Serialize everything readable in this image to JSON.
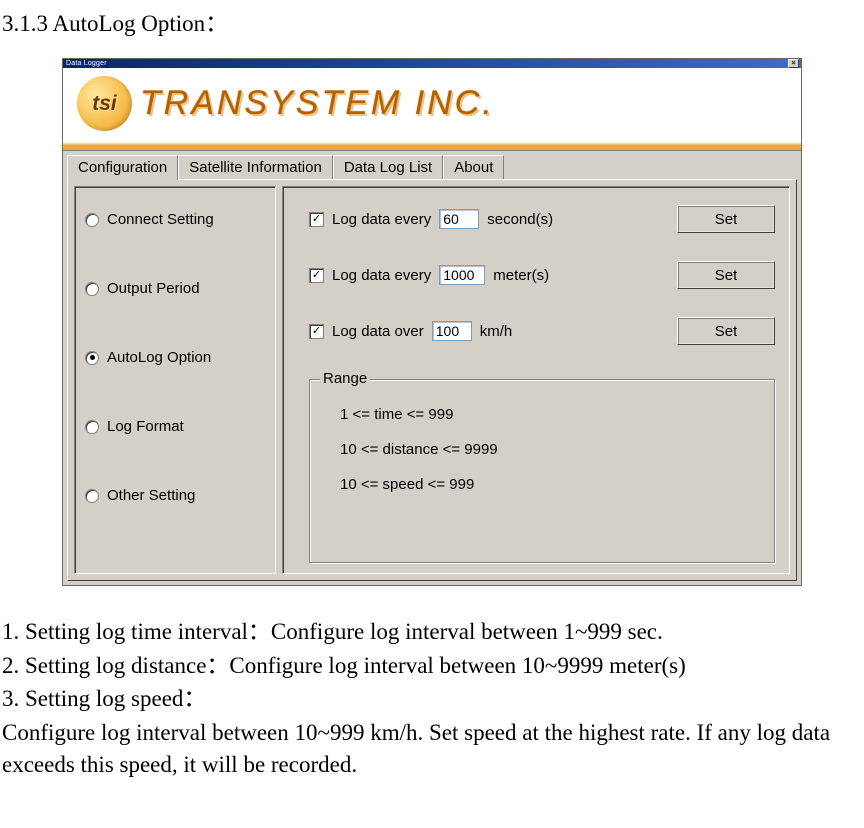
{
  "heading": "3.1.3 AutoLog Option：",
  "window": {
    "title": "Data Logger",
    "logo_tsi": "tsi",
    "logo_company": "TRANSYSTEM INC."
  },
  "tabs": {
    "items": [
      {
        "label": "Configuration",
        "active": true
      },
      {
        "label": "Satellite Information",
        "active": false
      },
      {
        "label": "Data Log List",
        "active": false
      },
      {
        "label": "About",
        "active": false
      }
    ]
  },
  "sidebar": {
    "items": [
      {
        "label": "Connect Setting",
        "checked": false
      },
      {
        "label": "Output Period",
        "checked": false
      },
      {
        "label": "AutoLog Option",
        "checked": true
      },
      {
        "label": "Log Format",
        "checked": false
      },
      {
        "label": "Other Setting",
        "checked": false
      }
    ]
  },
  "options": {
    "seconds": {
      "checked": true,
      "label_pre": "Log data every",
      "value": "60",
      "label_post": "second(s)",
      "btn": "Set"
    },
    "meters": {
      "checked": true,
      "label_pre": "Log data every",
      "value": "1000",
      "label_post": "meter(s)",
      "btn": "Set"
    },
    "speed": {
      "checked": true,
      "label_pre": "Log data over",
      "value": "100",
      "label_post": "km/h",
      "btn": "Set"
    }
  },
  "range": {
    "title": "Range",
    "lines": [
      "1 <= time <= 999",
      "10 <= distance <= 9999",
      "10 <= speed <= 999"
    ]
  },
  "description": {
    "l1": "1. Setting log time interval：Configure log interval between 1~999 sec.",
    "l2": "2. Setting log distance：Configure log interval between 10~9999 meter(s)",
    "l3": "3. Setting log speed：",
    "l4": "Configure log interval between 10~999 km/h. Set speed at the highest rate. If any log data exceeds this speed, it will be recorded."
  }
}
